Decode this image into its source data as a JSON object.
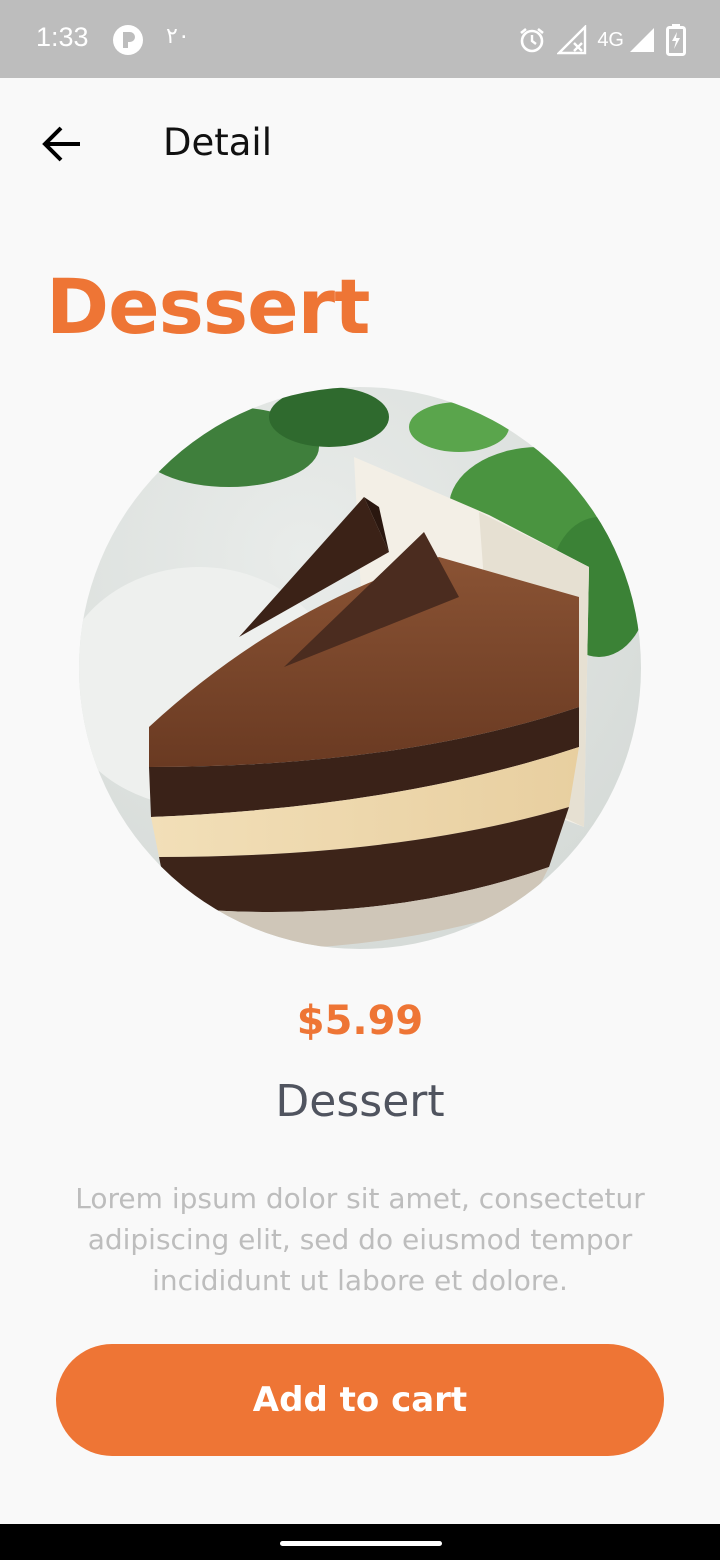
{
  "status_bar": {
    "time": "1:33",
    "locale_text": "٢٠",
    "network": "4G",
    "icons": [
      "app-notification-icon",
      "alarm-icon",
      "signal-off-icon",
      "signal-icon",
      "battery-charging-icon"
    ]
  },
  "app_bar": {
    "title": "Detail",
    "back_icon": "arrow-left-icon"
  },
  "page": {
    "heading": "Dessert"
  },
  "product": {
    "image": "chocolate-cake-slice",
    "price": "$5.99",
    "name": "Dessert",
    "description": "Lorem ipsum dolor sit amet, consectetur adipiscing elit, sed do eiusmod tempor incididunt ut labore et dolore."
  },
  "actions": {
    "add_to_cart_label": "Add to cart"
  },
  "colors": {
    "accent": "#ee7535",
    "background": "#f9f9f9",
    "status_bar": "#bdbdbd",
    "name_text": "#50545f",
    "description_text": "#bdbdbd"
  }
}
